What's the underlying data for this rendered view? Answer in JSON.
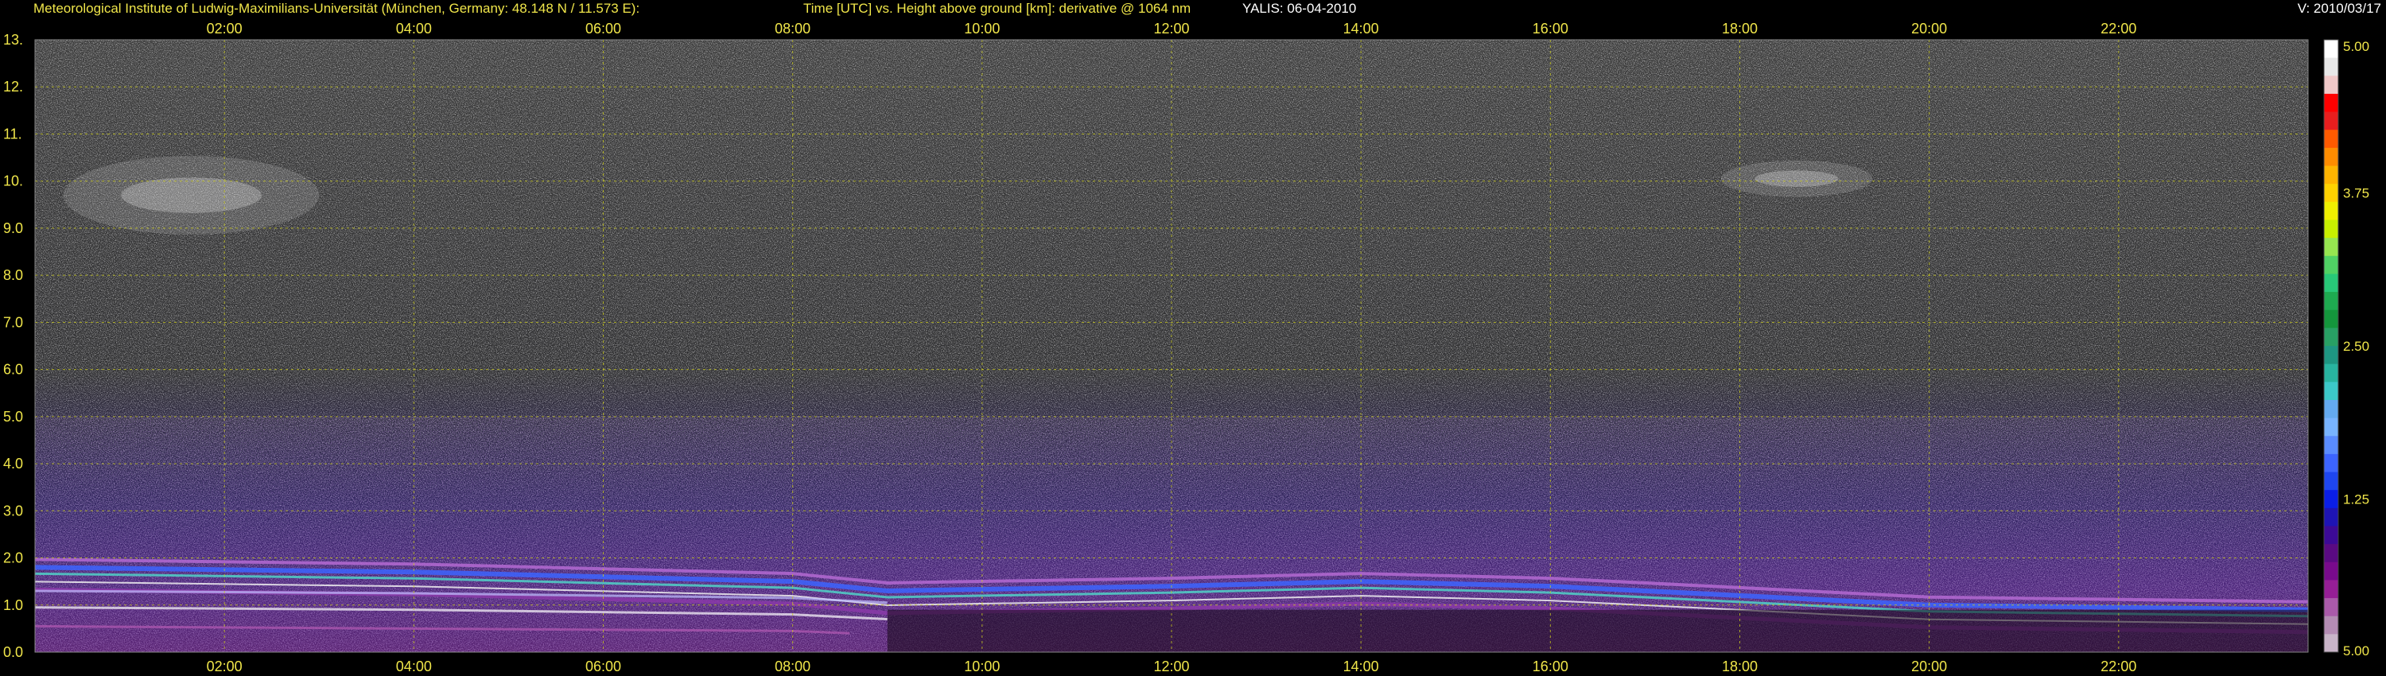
{
  "header": {
    "institute": "Meteorological Institute of Ludwig-Maximilians-Universität (München, Germany: 48.148 N / 11.573 E):",
    "title": "Time [UTC] vs. Height above ground [km]: derivative @ 1064 nm",
    "instrument": "YALIS: 06-04-2010",
    "version": "V: 2010/03/17"
  },
  "colors": {
    "text": "#f0e64a",
    "grid": "#c8c81e",
    "background": "#000000"
  },
  "chart_data": {
    "type": "heatmap",
    "title": "Time [UTC] vs. Height above ground [km]: derivative @ 1064 nm",
    "xlabel": "",
    "ylabel": "",
    "x_unit": "Time [UTC]",
    "y_unit": "Height above ground [km]",
    "xlim": [
      0.0,
      24.0
    ],
    "ylim": [
      0.0,
      13.0
    ],
    "grid": true,
    "x_ticks": [
      2,
      4,
      6,
      8,
      10,
      12,
      14,
      16,
      18,
      20,
      22
    ],
    "x_tick_labels": [
      "02:00",
      "04:00",
      "06:00",
      "08:00",
      "10:00",
      "12:00",
      "14:00",
      "16:00",
      "18:00",
      "20:00",
      "22:00"
    ],
    "y_ticks": [
      0,
      1,
      2,
      3,
      4,
      5,
      6,
      7,
      8,
      9,
      10,
      11,
      12,
      13
    ],
    "y_tick_labels": [
      "0.0",
      "1.0",
      "2.0",
      "3.0",
      "4.0",
      "5.0",
      "6.0",
      "7.0",
      "8.0",
      "9.0",
      "10.",
      "11.",
      "12.",
      "13."
    ],
    "colorbar": {
      "ticks": [
        5.0,
        3.75,
        2.5,
        1.25,
        5.0
      ],
      "tick_labels": [
        "5.00",
        "3.75",
        "2.50",
        "1.25",
        "5.00"
      ],
      "colors": [
        "#ffffff",
        "#e8e8e8",
        "#f0c8c8",
        "#ff0000",
        "#e81e1e",
        "#ff5a00",
        "#ff8c00",
        "#ffb400",
        "#ffd200",
        "#f0f000",
        "#c8f000",
        "#96e650",
        "#50d264",
        "#28c878",
        "#1eaa50",
        "#14963c",
        "#28a064",
        "#1e9682",
        "#28b4a0",
        "#3cc8c8",
        "#64aaf0",
        "#78b4ff",
        "#5a8cff",
        "#3c64ff",
        "#1e46f0",
        "#0a1ee6",
        "#1e14b4",
        "#3c0a96",
        "#5a0a82",
        "#780a8c",
        "#961e96",
        "#aa5aaa",
        "#b48cb4",
        "#c8b4c8"
      ]
    },
    "features": [
      {
        "name": "boundary layer top",
        "x": [
          0.0,
          4.0,
          8.0,
          9.0,
          12.0,
          14.0,
          16.0,
          18.0,
          20.0,
          22.0,
          24.0
        ],
        "y": [
          1.8,
          1.7,
          1.5,
          1.3,
          1.4,
          1.5,
          1.4,
          1.2,
          1.0,
          0.95,
          0.9
        ]
      },
      {
        "name": "cirrus",
        "x": [
          0.3,
          3.0
        ],
        "y": [
          9.0,
          10.4
        ]
      },
      {
        "name": "cirrus",
        "x": [
          17.8,
          19.4
        ],
        "y": [
          9.8,
          10.3
        ]
      }
    ]
  }
}
